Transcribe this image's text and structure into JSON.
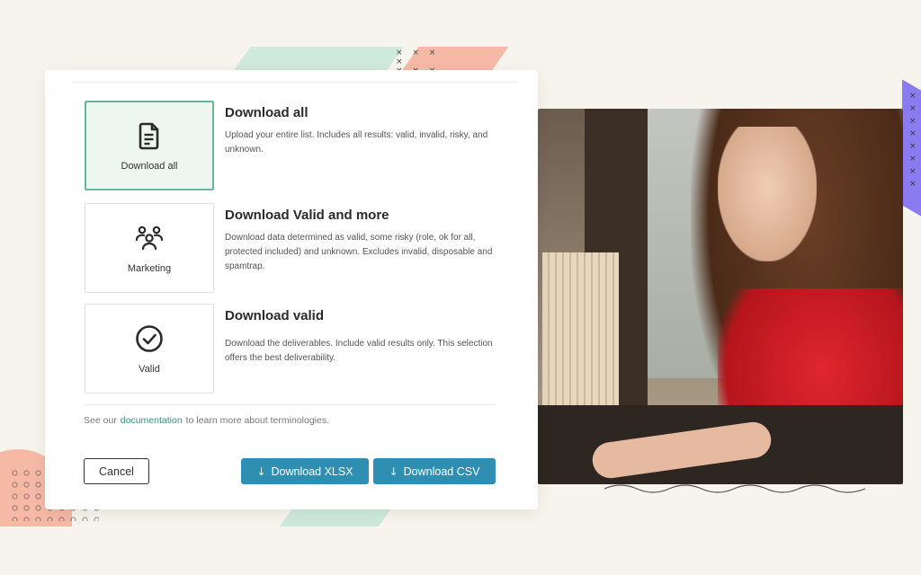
{
  "options": [
    {
      "card_label": "Download all",
      "icon": "document-icon",
      "title": "Download all",
      "description": "Upload your entire list. Includes all results: valid, invalid, risky, and unknown.",
      "selected": true
    },
    {
      "card_label": "Marketing",
      "icon": "people-group-icon",
      "title": "Download Valid and more",
      "description": "Download data determined as valid, some risky (role, ok for all, protected included) and unknown. Excludes invalid, disposable and spamtrap.",
      "selected": false
    },
    {
      "card_label": "Valid",
      "icon": "check-circle-icon",
      "title": "Download valid",
      "description": "Download the deliverables. Include valid results only. This selection offers the best deliverability.",
      "selected": false
    }
  ],
  "footnote": {
    "prefix": "See our",
    "link": "documentation",
    "suffix": "to learn more about terminologies."
  },
  "buttons": {
    "cancel": "Cancel",
    "xlsx": "Download XLSX",
    "csv": "Download CSV"
  },
  "colors": {
    "accent_button": "#2f8fb3",
    "selected_border": "#6bb59c",
    "link": "#3a8f86"
  }
}
